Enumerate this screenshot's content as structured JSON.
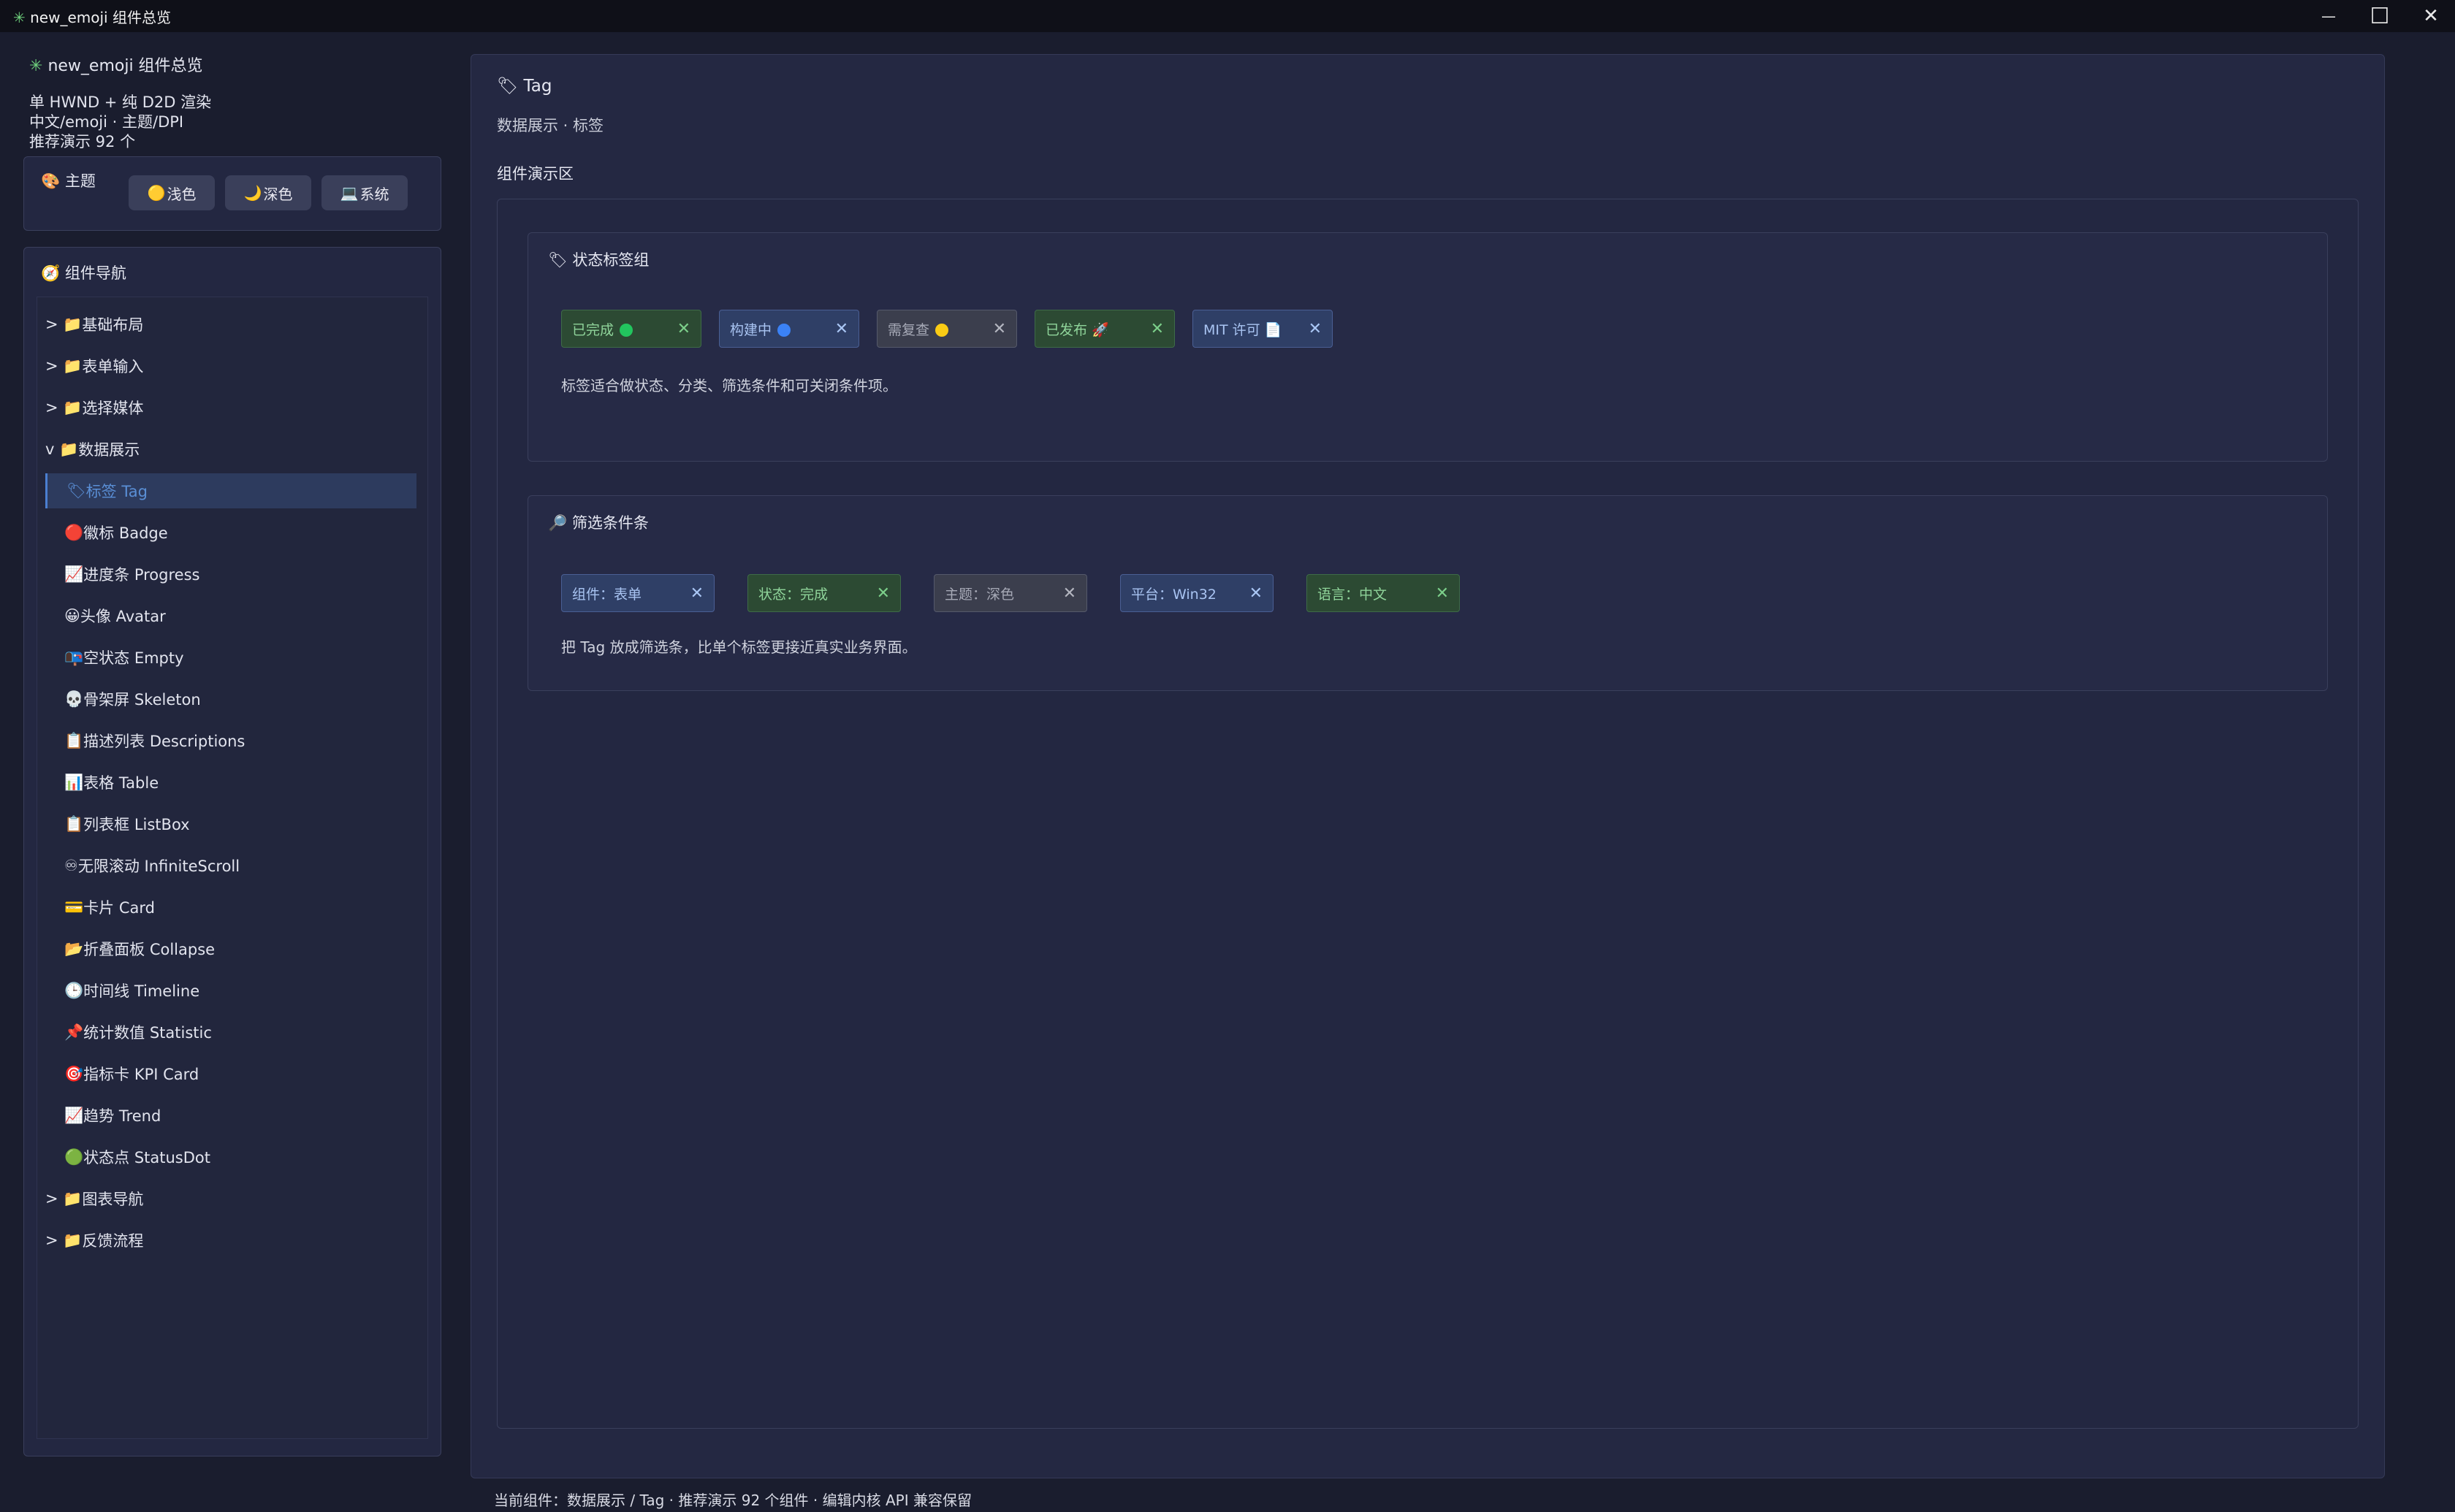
{
  "window": {
    "title": "new_emoji 组件总览",
    "controls": {
      "minimize": "—",
      "maximize": "☐",
      "close": "✕"
    }
  },
  "sidebar": {
    "app_title": "new_emoji 组件总览",
    "info_lines": [
      "单 HWND + 纯 D2D 渲染",
      "中文/emoji · 主题/DPI",
      "推荐演示 92 个"
    ],
    "theme": {
      "label": "主题",
      "buttons": [
        {
          "icon": "🟡",
          "label": "浅色"
        },
        {
          "icon": "🌙",
          "label": "深色"
        },
        {
          "icon": "💻",
          "label": "系统"
        }
      ]
    },
    "nav": {
      "label": "组件导航",
      "items": [
        {
          "prefix": "> 📁",
          "label": "基础布局"
        },
        {
          "prefix": "> 📁",
          "label": "表单输入"
        },
        {
          "prefix": "> 📁",
          "label": "选择媒体"
        },
        {
          "prefix": "v 📁",
          "label": "数据展示"
        },
        {
          "prefix": "🏷",
          "label": "标签 Tag"
        },
        {
          "prefix": "🔴",
          "label": "徽标 Badge"
        },
        {
          "prefix": "📈",
          "label": "进度条 Progress"
        },
        {
          "prefix": "😀",
          "label": "头像 Avatar"
        },
        {
          "prefix": "📭",
          "label": "空状态 Empty"
        },
        {
          "prefix": "💀",
          "label": "骨架屏 Skeleton"
        },
        {
          "prefix": "📋",
          "label": "描述列表 Descriptions"
        },
        {
          "prefix": "📊",
          "label": "表格 Table"
        },
        {
          "prefix": "📋",
          "label": "列表框 ListBox"
        },
        {
          "prefix": "♾",
          "label": "无限滚动 InfiniteScroll"
        },
        {
          "prefix": "💳",
          "label": "卡片 Card"
        },
        {
          "prefix": "📂",
          "label": "折叠面板 Collapse"
        },
        {
          "prefix": "🕒",
          "label": "时间线 Timeline"
        },
        {
          "prefix": "📌",
          "label": "统计数值 Statistic"
        },
        {
          "prefix": "🎯",
          "label": "指标卡 KPI Card"
        },
        {
          "prefix": "📈",
          "label": "趋势 Trend"
        },
        {
          "prefix": "🟢",
          "label": "状态点 StatusDot"
        },
        {
          "prefix": "> 📁",
          "label": "图表导航"
        },
        {
          "prefix": "> 📁",
          "label": "反馈流程"
        }
      ]
    }
  },
  "main": {
    "title": "Tag",
    "subtitle": "数据展示 · 标签",
    "demo_label": "组件演示区",
    "status_card": {
      "title": "状态标签组",
      "tags": [
        {
          "label": "已完成",
          "marker": "🟢",
          "close": "✕",
          "style": "green"
        },
        {
          "label": "构建中",
          "marker": "🔵",
          "close": "✕",
          "style": "blue"
        },
        {
          "label": "需复查",
          "marker": "🟡",
          "close": "✕",
          "style": "gray"
        },
        {
          "label": "已发布",
          "marker": "🚀",
          "close": "✕",
          "style": "green"
        },
        {
          "label": "MIT 许可",
          "marker": "📄",
          "close": "✕",
          "style": "blue"
        }
      ],
      "description": "标签适合做状态、分类、筛选条件和可关闭条件项。"
    },
    "filter_card": {
      "title": "筛选条件条",
      "tags": [
        {
          "label": "组件：表单",
          "close": "✕",
          "style": "blue"
        },
        {
          "label": "状态：完成",
          "close": "✕",
          "style": "green"
        },
        {
          "label": "主题：深色",
          "close": "✕",
          "style": "gray"
        },
        {
          "label": "平台：Win32",
          "close": "✕",
          "style": "blue"
        },
        {
          "label": "语言：中文",
          "close": "✕",
          "style": "green"
        }
      ],
      "description": "把 Tag 放成筛选条，比单个标签更接近真实业务界面。"
    }
  },
  "status_bar": "当前组件：数据展示 / Tag · 推荐演示 92 个组件 · 编辑内核 API 兼容保留",
  "colors": {
    "background": "#1a1d2e",
    "panel": "#232741",
    "accent": "#4b7fd1",
    "tag_green": "#2c4a33",
    "tag_blue": "#2f3f66",
    "tag_gray": "#3b3e4d"
  }
}
